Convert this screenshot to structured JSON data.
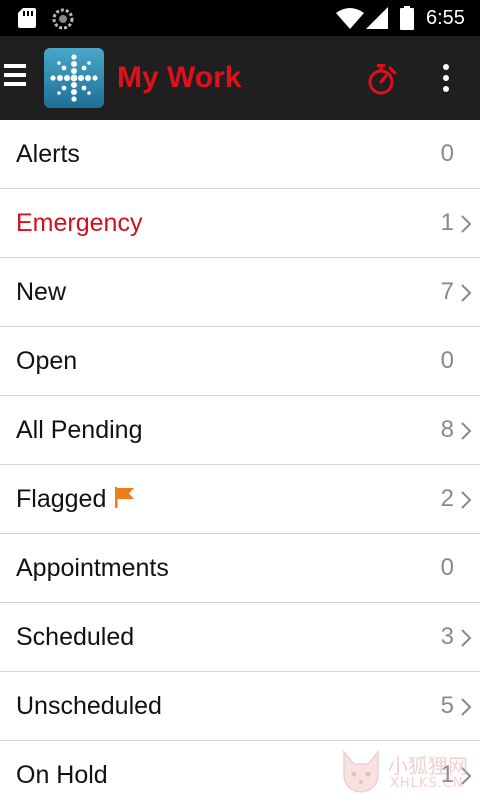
{
  "status_bar": {
    "time": "6:55"
  },
  "app_bar": {
    "title": "My Work",
    "title_color": "#e0101a",
    "icons": [
      "menu-icon",
      "app-logo-icon",
      "stopwatch-icon",
      "more-vert-icon"
    ]
  },
  "list": {
    "rows": [
      {
        "label": "Alerts",
        "count": "0",
        "chevron": false
      },
      {
        "label": "Emergency",
        "count": "1",
        "chevron": true,
        "color": "#d0121b"
      },
      {
        "label": "New",
        "count": "7",
        "chevron": true
      },
      {
        "label": "Open",
        "count": "0",
        "chevron": false
      },
      {
        "label": "All Pending",
        "count": "8",
        "chevron": true
      },
      {
        "label": "Flagged",
        "count": "2",
        "chevron": true,
        "icon": "flag-icon"
      },
      {
        "label": "Appointments",
        "count": "0",
        "chevron": false
      },
      {
        "label": "Scheduled",
        "count": "3",
        "chevron": true
      },
      {
        "label": "Unscheduled",
        "count": "5",
        "chevron": true
      },
      {
        "label": "On Hold",
        "count": "1",
        "chevron": true
      }
    ]
  },
  "watermark": {
    "text_cn": "小狐狸网",
    "text_en": "XHLKS.CN"
  }
}
